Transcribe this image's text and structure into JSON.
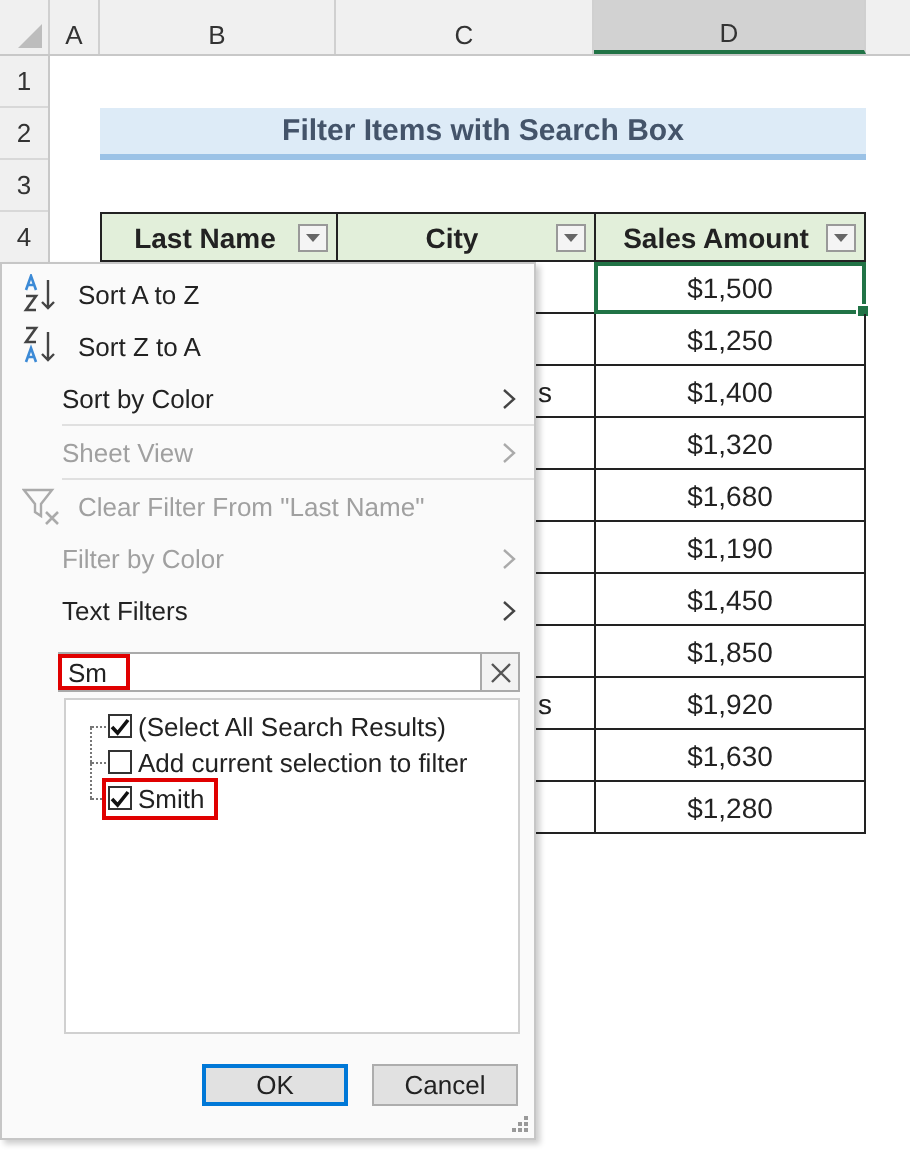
{
  "column_headers": [
    {
      "label": "A",
      "selected": false
    },
    {
      "label": "B",
      "selected": false
    },
    {
      "label": "C",
      "selected": false
    },
    {
      "label": "D",
      "selected": true
    }
  ],
  "row_numbers": [
    "1",
    "2",
    "3",
    "4"
  ],
  "title": "Filter Items with Search Box",
  "table": {
    "columns": [
      {
        "label": "Last Name"
      },
      {
        "label": "City"
      },
      {
        "label": "Sales Amount"
      }
    ],
    "rows": [
      {
        "amount": "$1,500",
        "selected": true
      },
      {
        "amount": "$1,250",
        "selected": false
      },
      {
        "amount": "$1,400",
        "selected": false,
        "city_fragment": "s"
      },
      {
        "amount": "$1,320",
        "selected": false
      },
      {
        "amount": "$1,680",
        "selected": false
      },
      {
        "amount": "$1,190",
        "selected": false
      },
      {
        "amount": "$1,450",
        "selected": false
      },
      {
        "amount": "$1,850",
        "selected": false
      },
      {
        "amount": "$1,920",
        "selected": false,
        "city_fragment": "s"
      },
      {
        "amount": "$1,630",
        "selected": false
      },
      {
        "amount": "$1,280",
        "selected": false
      }
    ]
  },
  "filter_menu": {
    "items": [
      {
        "kind": "sort_asc",
        "label": "Sort A to Z",
        "disabled": false,
        "submenu": false
      },
      {
        "kind": "sort_desc",
        "label": "Sort Z to A",
        "disabled": false,
        "submenu": false
      },
      {
        "kind": "plain",
        "label": "Sort by Color",
        "disabled": false,
        "submenu": true
      },
      {
        "kind": "separator"
      },
      {
        "kind": "plain",
        "label": "Sheet View",
        "disabled": true,
        "submenu": true
      },
      {
        "kind": "separator"
      },
      {
        "kind": "clear_filter",
        "label": "Clear Filter From \"Last Name\"",
        "disabled": true,
        "submenu": false
      },
      {
        "kind": "plain",
        "label": "Filter by Color",
        "disabled": true,
        "submenu": true
      },
      {
        "kind": "plain",
        "label": "Text Filters",
        "disabled": false,
        "submenu": true
      }
    ],
    "search": {
      "value": "Sm",
      "highlighted": true
    },
    "results": [
      {
        "label": "(Select All Search Results)",
        "checked": true,
        "highlighted": false
      },
      {
        "label": "Add current selection to filter",
        "checked": false,
        "highlighted": false
      },
      {
        "label": "Smith",
        "checked": true,
        "highlighted": true
      }
    ],
    "buttons": [
      {
        "label": "OK",
        "selected": true
      },
      {
        "label": "Cancel",
        "selected": false
      }
    ]
  }
}
